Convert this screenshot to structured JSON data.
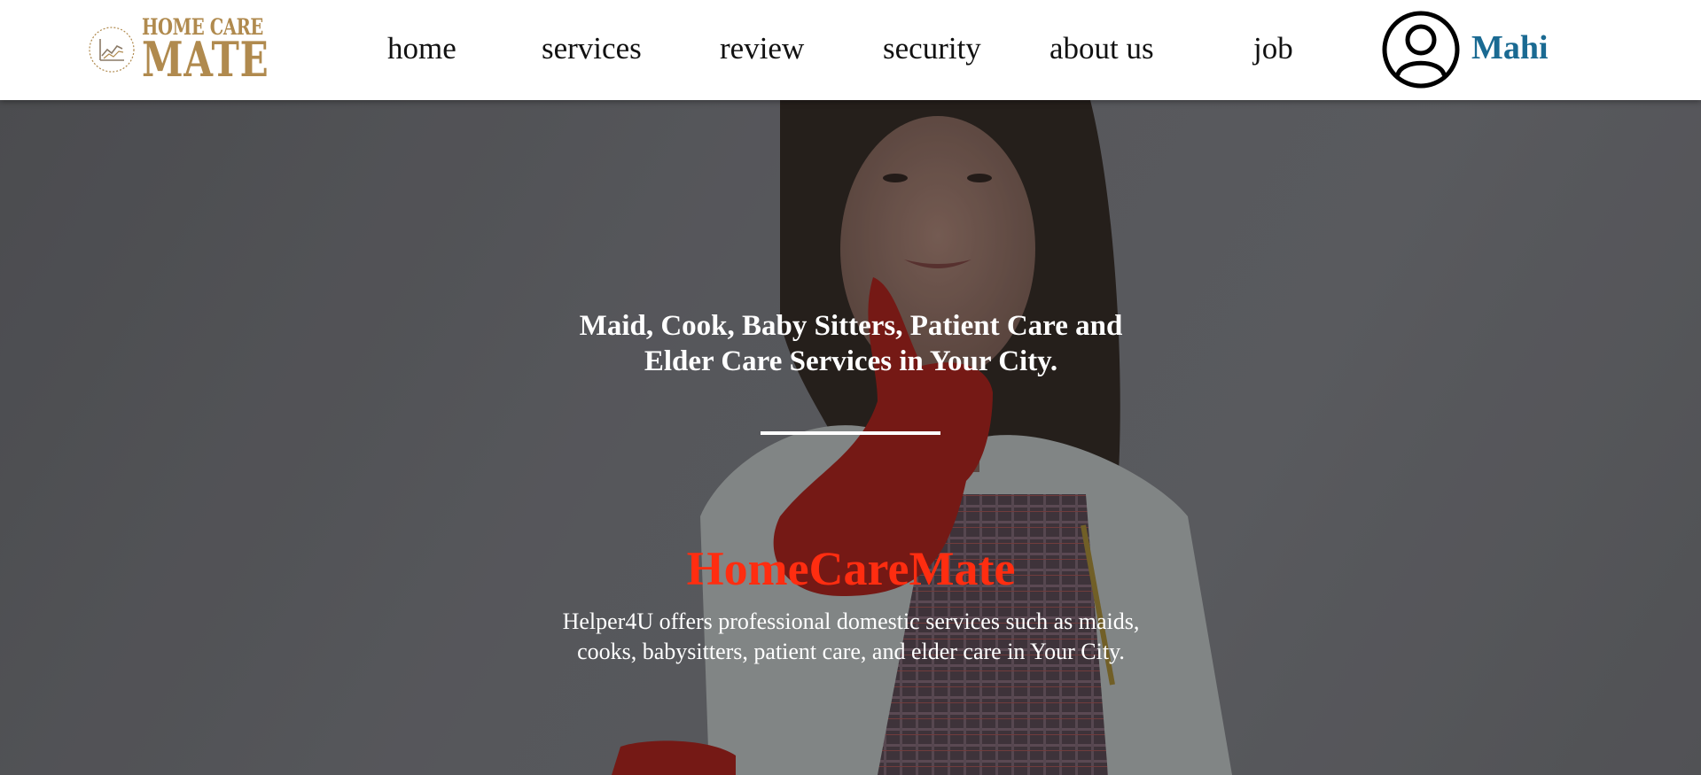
{
  "header": {
    "logo": {
      "line1": "HOME CARE",
      "line2": "MATE",
      "emblem_icon": "chart-trend-icon"
    },
    "nav": [
      {
        "label": "home"
      },
      {
        "label": "services"
      },
      {
        "label": "review"
      },
      {
        "label": "security"
      },
      {
        "label": "about us"
      },
      {
        "label": "job"
      }
    ],
    "user": {
      "avatar_icon": "user-circle-icon",
      "name": "Mahi"
    }
  },
  "hero": {
    "tagline_line1": "Maid, Cook, Baby Sitters, Patient Care and",
    "tagline_line2": "Elder Care Services in Your City.",
    "brand_title": "HomeCareMate",
    "description_line1": "Helper4U offers professional domestic services such as maids,",
    "description_line2": "cooks, babysitters, patient care, and elder care in Your City."
  },
  "colors": {
    "brand_gold": "#b08a4e",
    "brand_red": "#ff2d10",
    "user_name_blue": "#1a6a92",
    "hero_text": "#ffffff"
  }
}
